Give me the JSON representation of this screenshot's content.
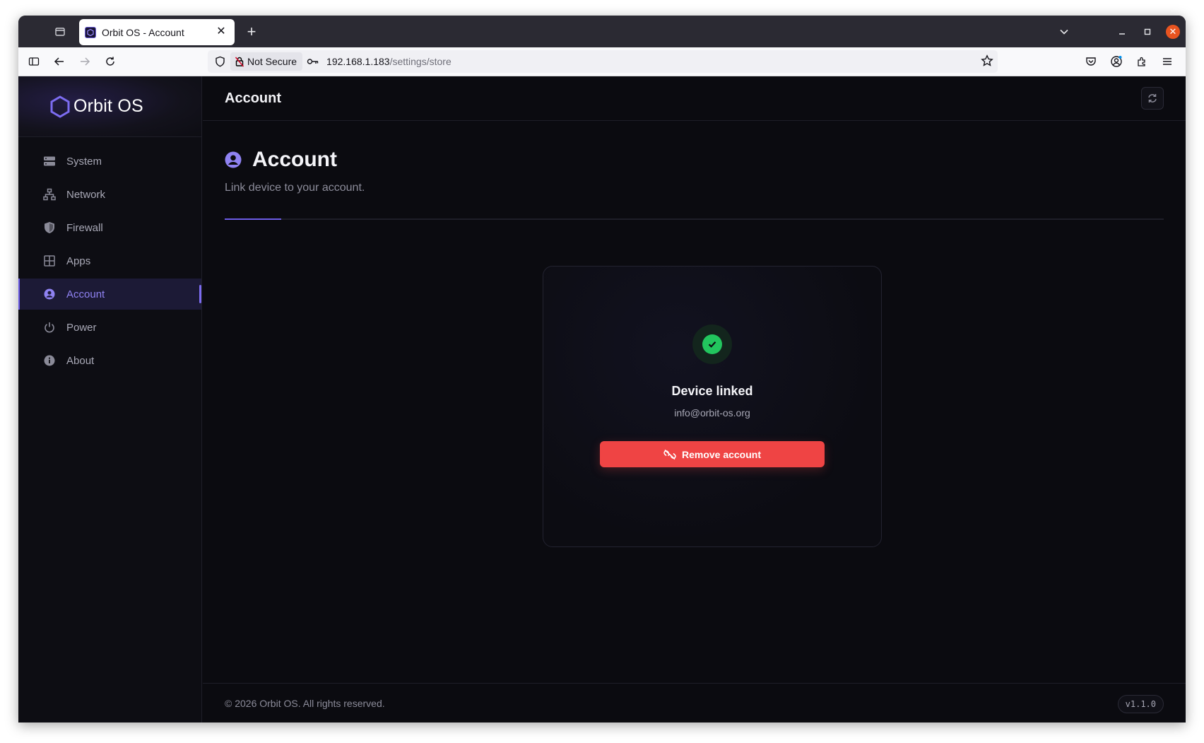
{
  "browser": {
    "tab_title": "Orbit OS - Account",
    "url_security": "Not Secure",
    "url_host": "192.168.1.183",
    "url_path": "/settings/store"
  },
  "brand": {
    "name": "Orbit OS",
    "accent": "#6c5ce7"
  },
  "sidebar": {
    "items": [
      {
        "label": "System",
        "icon": "server-icon"
      },
      {
        "label": "Network",
        "icon": "network-icon"
      },
      {
        "label": "Firewall",
        "icon": "shield-icon"
      },
      {
        "label": "Apps",
        "icon": "grid-icon"
      },
      {
        "label": "Account",
        "icon": "user-circle-icon",
        "active": true
      },
      {
        "label": "Power",
        "icon": "power-icon"
      },
      {
        "label": "About",
        "icon": "info-icon"
      }
    ]
  },
  "topbar": {
    "title": "Account"
  },
  "page": {
    "title": "Account",
    "subtitle": "Link device to your account."
  },
  "card": {
    "status_title": "Device linked",
    "email": "info@orbit-os.org",
    "remove_label": "Remove account",
    "status_color": "#22c55e",
    "danger_color": "#ef4444"
  },
  "footer": {
    "copyright": "© 2026 Orbit OS. All rights reserved.",
    "version": "v1.1.0"
  }
}
